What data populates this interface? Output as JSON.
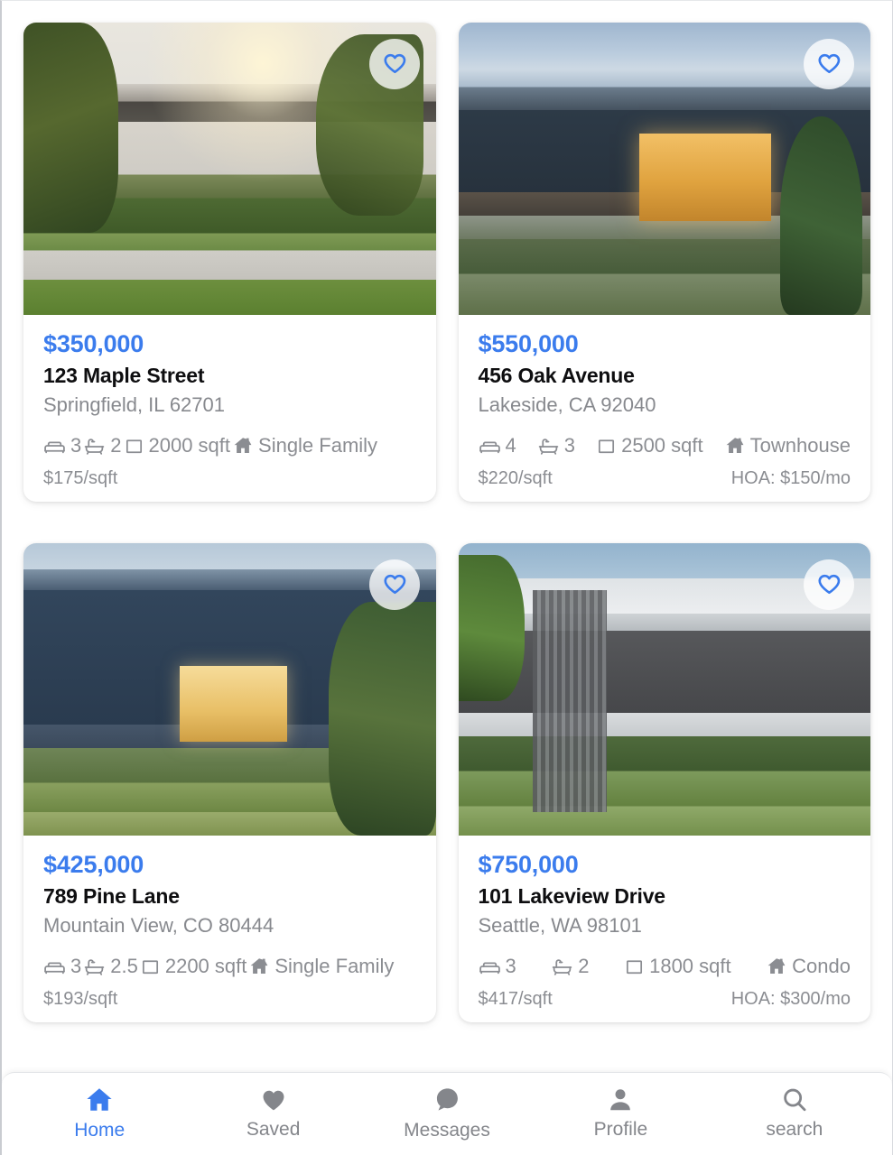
{
  "theme": {
    "accent": "#3b7ced",
    "text_primary": "#0e0e10",
    "text_muted": "#8b8d92",
    "card_bg": "#ffffff",
    "page_bg": "#ffffff"
  },
  "listings": [
    {
      "price": "$350,000",
      "address": "123 Maple Street",
      "location": "Springfield, IL 62701",
      "beds": "3",
      "baths": "2",
      "sqft": "2000 sqft",
      "type": "Single Family",
      "price_per_sqft": "$175/sqft",
      "hoa": "",
      "favorite_icon": "heart-outline-icon",
      "photo": "modern-white-house-photo"
    },
    {
      "price": "$550,000",
      "address": "456 Oak Avenue",
      "location": "Lakeside, CA 92040",
      "beds": "4",
      "baths": "3",
      "sqft": "2500 sqft",
      "type": "Townhouse",
      "price_per_sqft": "$220/sqft",
      "hoa": "HOA: $150/mo",
      "favorite_icon": "heart-outline-icon",
      "photo": "navy-modern-house-photo"
    },
    {
      "price": "$425,000",
      "address": "789 Pine Lane",
      "location": "Mountain View, CO 80444",
      "beds": "3",
      "baths": "2.5",
      "sqft": "2200 sqft",
      "type": "Single Family",
      "price_per_sqft": "$193/sqft",
      "hoa": "",
      "favorite_icon": "heart-outline-icon",
      "photo": "blue-craftsman-house-photo"
    },
    {
      "price": "$750,000",
      "address": "101 Lakeview Drive",
      "location": "Seattle, WA 98101",
      "beds": "3",
      "baths": "2",
      "sqft": "1800 sqft",
      "type": "Condo",
      "price_per_sqft": "$417/sqft",
      "hoa": "HOA: $300/mo",
      "favorite_icon": "heart-outline-icon",
      "photo": "white-cantilever-house-photo"
    }
  ],
  "bottom_nav": {
    "items": [
      {
        "label": "Home",
        "icon": "home-icon",
        "active": true
      },
      {
        "label": "Saved",
        "icon": "heart-filled-icon",
        "active": false
      },
      {
        "label": "Messages",
        "icon": "chat-bubble-icon",
        "active": false
      },
      {
        "label": "Profile",
        "icon": "person-icon",
        "active": false
      },
      {
        "label": "search",
        "icon": "search-icon",
        "active": false
      }
    ]
  }
}
